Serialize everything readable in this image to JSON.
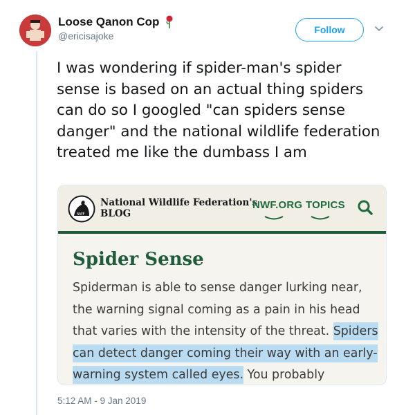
{
  "tweet": {
    "author": {
      "display_name": "Loose Qanon Cop",
      "handle": "@ericisajoke",
      "badge_icon": "rose-icon"
    },
    "follow_label": "Follow",
    "more_icon": "chevron-down-icon",
    "text": "I was wondering if spider-man's spider sense is based on an actual thing spiders can do so I googled \"can spiders sense danger\" and the national wildlife federation treated me like the dumbass I am",
    "timestamp": "5:12 AM - 9 Jan 2019"
  },
  "card": {
    "blog_title_line1": "National Wildlife Federation's",
    "blog_title_line2": "BLOG",
    "nav": [
      "NWF.ORG",
      "TOPICS"
    ],
    "search_icon": "search-icon",
    "article_title": "Spider Sense",
    "excerpt_plain": "Spiderman is able to sense danger lurking near, the warning signal coming as a pain in his head that varies with the intensity of the threat. ",
    "excerpt_highlight": "Spiders can detect danger coming their way with an early-warning system called eyes.",
    "excerpt_tail": " You probably"
  },
  "colors": {
    "twitter_blue": "#1da1f2",
    "nwf_green": "#1f5c3a",
    "highlight": "#b9dcf2"
  }
}
